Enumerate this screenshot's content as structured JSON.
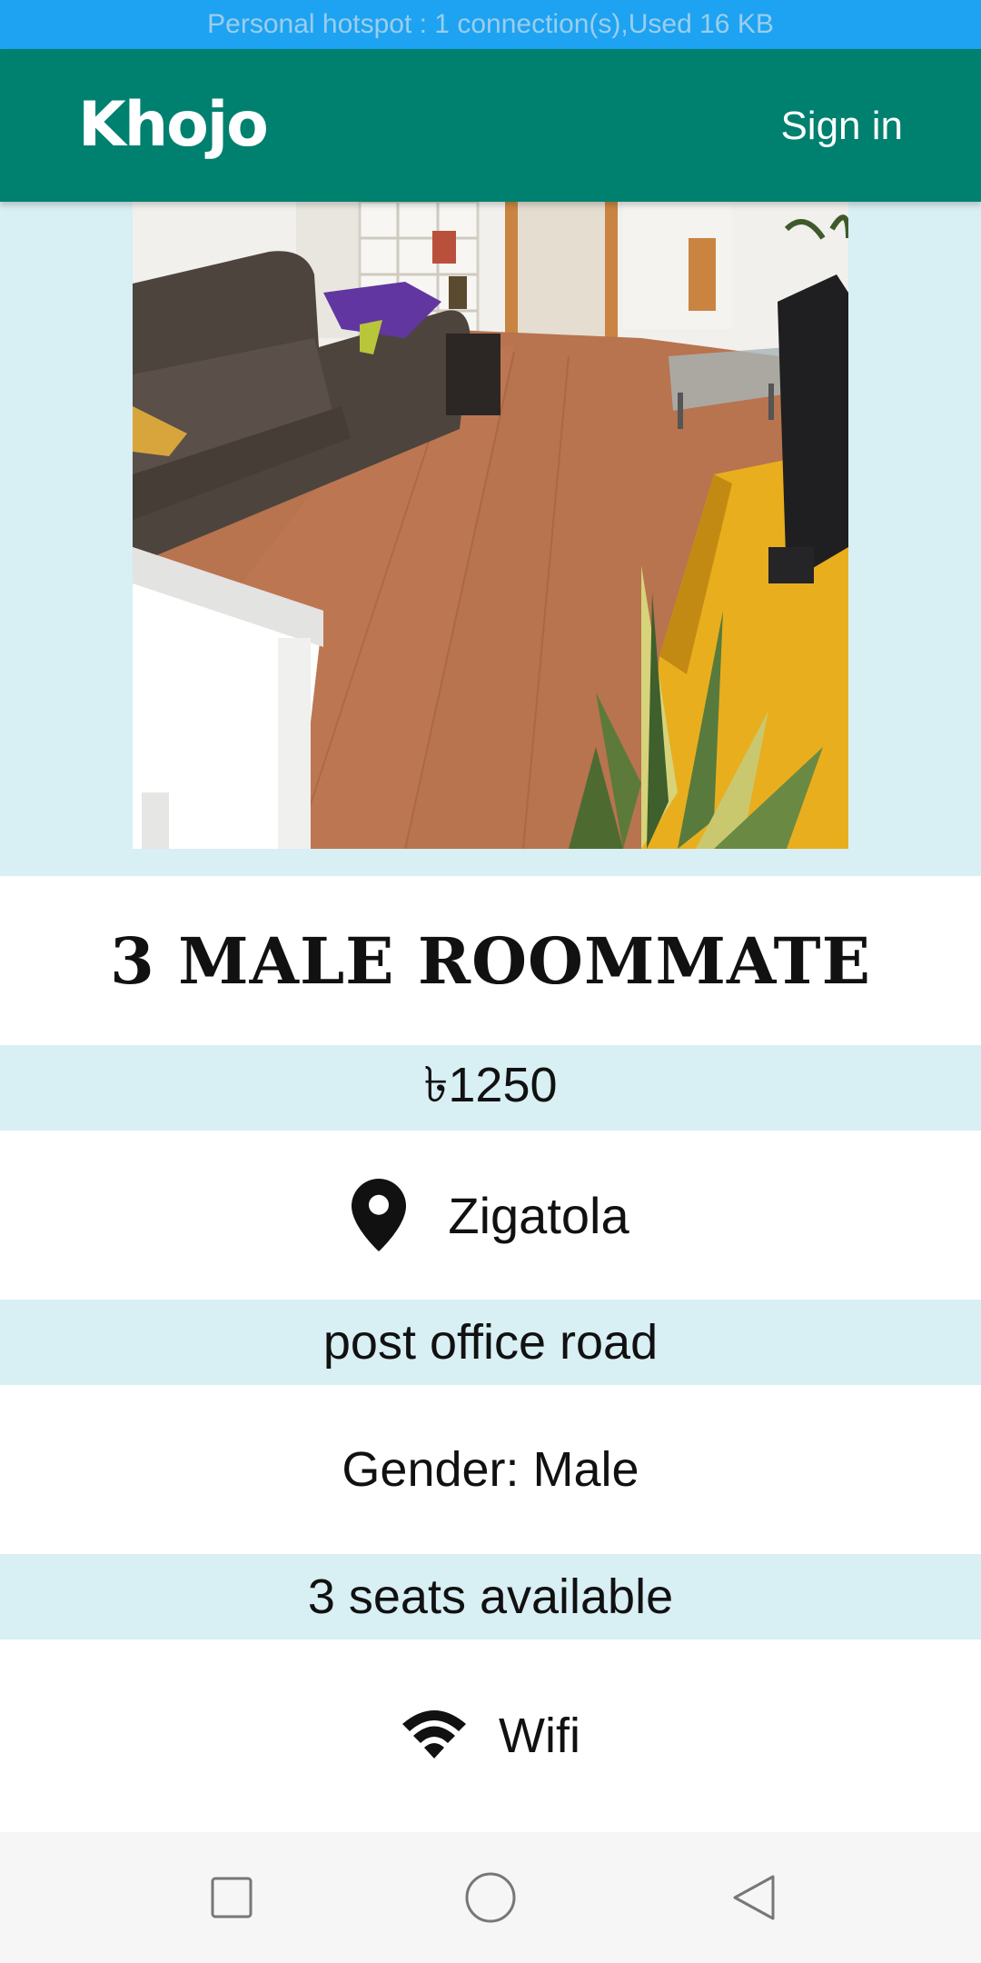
{
  "status_bar": {
    "text": "Personal hotspot : 1 connection(s),Used  16 KB"
  },
  "app_bar": {
    "title": "Khojo",
    "sign_in_label": "Sign in"
  },
  "listing": {
    "title": "3 MALE ROOMMATE",
    "price": "৳1250",
    "area": "Zigatola",
    "address": "post office road",
    "gender": "Gender: Male",
    "seats": "3 seats available",
    "amenities": [
      "Wifi"
    ]
  },
  "icons": {
    "location": "location-pin-icon",
    "wifi": "wifi-icon",
    "nav_recents": "square-recents-icon",
    "nav_home": "circle-home-icon",
    "nav_back": "triangle-back-icon"
  },
  "colors": {
    "status_bar": "#1da3f2",
    "app_bar": "#00806f",
    "row_alt": "#d8eff4",
    "nav_bar": "#f6f6f6"
  }
}
